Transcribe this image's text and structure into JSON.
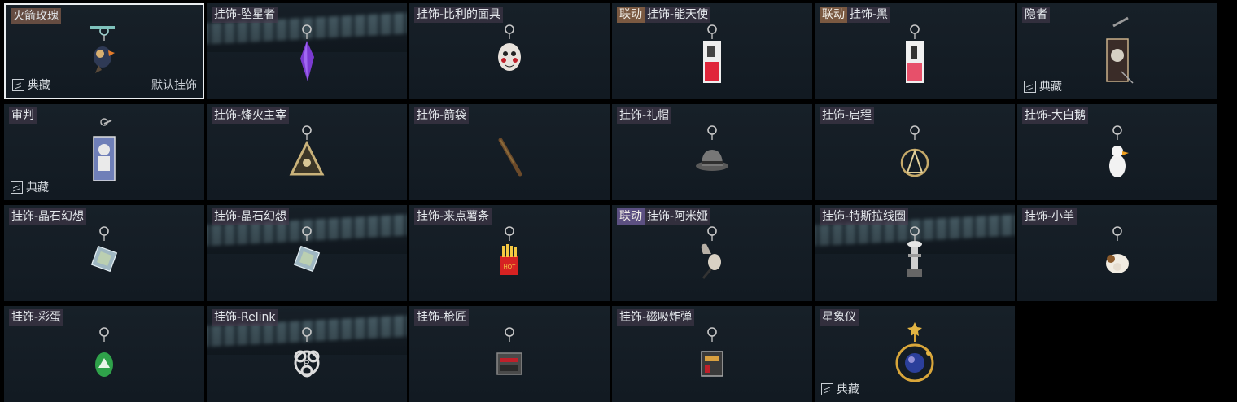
{
  "items": [
    {
      "name": "火箭玫瑰",
      "collab": "",
      "collection": "典藏",
      "default": "默认挂饰",
      "icon": "rocket-rose-charm-icon",
      "selected": true,
      "glow": false
    },
    {
      "name": "挂饰-坠星者",
      "collab": "",
      "collection": "",
      "default": "",
      "icon": "falling-star-crystal-charm-icon",
      "selected": false,
      "glow": true
    },
    {
      "name": "挂饰-比利的面具",
      "collab": "",
      "collection": "",
      "default": "",
      "icon": "billy-mask-charm-icon",
      "selected": false,
      "glow": false
    },
    {
      "name": "挂饰-能天使",
      "collab": "联动",
      "collabStyle": "brown",
      "collection": "",
      "default": "",
      "icon": "exusiai-card-charm-icon",
      "selected": false,
      "glow": false
    },
    {
      "name": "挂饰-黑",
      "collab": "联动",
      "collabStyle": "brown",
      "collection": "",
      "default": "",
      "icon": "schwarz-card-charm-icon",
      "selected": false,
      "glow": false
    },
    {
      "name": "隐者",
      "collab": "",
      "collection": "典藏",
      "default": "",
      "icon": "hermit-tarot-charm-icon",
      "selected": false,
      "glow": false
    },
    {
      "name": "审判",
      "collab": "",
      "collection": "典藏",
      "default": "",
      "icon": "judgement-tarot-charm-icon",
      "selected": false,
      "glow": false
    },
    {
      "name": "挂饰-烽火主宰",
      "collab": "",
      "collection": "",
      "default": "",
      "icon": "triangle-skull-charm-icon",
      "selected": false,
      "glow": false
    },
    {
      "name": "挂饰-箭袋",
      "collab": "",
      "collection": "",
      "default": "",
      "icon": "quiver-charm-icon",
      "selected": false,
      "glow": false
    },
    {
      "name": "挂饰-礼帽",
      "collab": "",
      "collection": "",
      "default": "",
      "icon": "hat-charm-icon",
      "selected": false,
      "glow": false
    },
    {
      "name": "挂饰-启程",
      "collab": "",
      "collection": "",
      "default": "",
      "icon": "compass-charm-icon",
      "selected": false,
      "glow": false
    },
    {
      "name": "挂饰-大白鹅",
      "collab": "",
      "collection": "",
      "default": "",
      "icon": "goose-charm-icon",
      "selected": false,
      "glow": false
    },
    {
      "name": "挂饰-晶石幻想",
      "collab": "",
      "collection": "",
      "default": "",
      "icon": "crystal-cube-charm-icon",
      "selected": false,
      "glow": false
    },
    {
      "name": "挂饰-晶石幻想",
      "collab": "",
      "collection": "",
      "default": "",
      "icon": "crystal-cube-charm-icon",
      "selected": false,
      "glow": true
    },
    {
      "name": "挂饰-来点薯条",
      "collab": "",
      "collection": "",
      "default": "",
      "icon": "fries-charm-icon",
      "selected": false,
      "glow": false
    },
    {
      "name": "挂饰-阿米娅",
      "collab": "联动",
      "collabStyle": "purple",
      "collection": "",
      "default": "",
      "icon": "amiya-charm-icon",
      "selected": false,
      "glow": false
    },
    {
      "name": "挂饰-特斯拉线圈",
      "collab": "",
      "collection": "",
      "default": "",
      "icon": "tesla-coil-charm-icon",
      "selected": false,
      "glow": true
    },
    {
      "name": "挂饰-小羊",
      "collab": "",
      "collection": "",
      "default": "",
      "icon": "sheep-charm-icon",
      "selected": false,
      "glow": false
    },
    {
      "name": "挂饰-彩蛋",
      "collab": "",
      "collection": "",
      "default": "",
      "icon": "easter-egg-charm-icon",
      "selected": false,
      "glow": false
    },
    {
      "name": "挂饰-Relink",
      "collab": "",
      "collection": "",
      "default": "",
      "icon": "relink-knot-charm-icon",
      "selected": false,
      "glow": true
    },
    {
      "name": "挂饰-枪匠",
      "collab": "",
      "collection": "",
      "default": "",
      "icon": "gunsmith-case-charm-icon",
      "selected": false,
      "glow": false
    },
    {
      "name": "挂饰-磁吸炸弹",
      "collab": "",
      "collection": "",
      "default": "",
      "icon": "magnetic-bomb-charm-icon",
      "selected": false,
      "glow": false
    },
    {
      "name": "星象仪",
      "collab": "",
      "collection": "典藏",
      "default": "",
      "icon": "orrery-charm-icon",
      "selected": false,
      "glow": false
    }
  ],
  "colors": {
    "accent_selected": "#e9edf0",
    "collab_purple": "#64558c",
    "collab_brown": "#8c6446",
    "tile_bg": "#141c24"
  }
}
